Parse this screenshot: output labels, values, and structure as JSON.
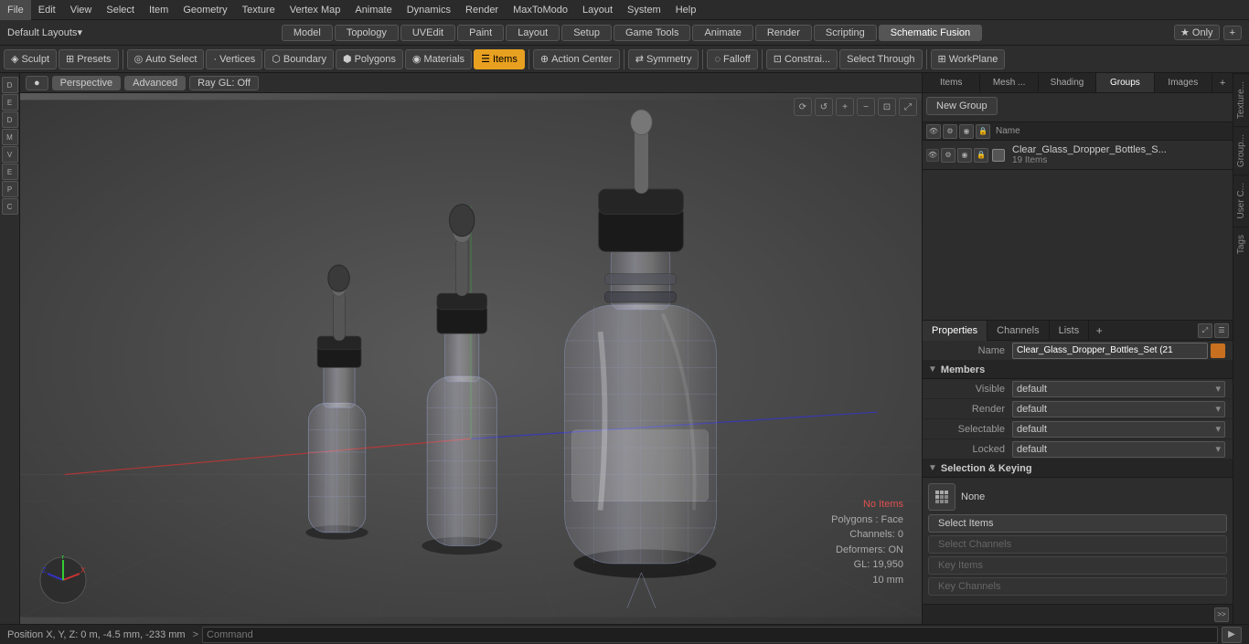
{
  "menubar": {
    "items": [
      "File",
      "Edit",
      "View",
      "Select",
      "Item",
      "Geometry",
      "Texture",
      "Vertex Map",
      "Animate",
      "Dynamics",
      "Render",
      "MaxToModo",
      "Layout",
      "System",
      "Help"
    ]
  },
  "layout_bar": {
    "layout_label": "Default Layouts",
    "tabs": [
      "Model",
      "Topology",
      "UVEdit",
      "Paint",
      "Layout",
      "Setup",
      "Game Tools",
      "Animate",
      "Render",
      "Scripting",
      "Schematic Fusion"
    ],
    "active_tab": "Schematic Fusion",
    "star_label": "★ Only",
    "plus_label": "+"
  },
  "toolbar": {
    "sculpt": "Sculpt",
    "presets": "Presets",
    "auto_select": "Auto Select",
    "vertices": "Vertices",
    "boundary": "Boundary",
    "polygons": "Polygons",
    "materials": "Materials",
    "items": "Items",
    "action_center": "Action Center",
    "symmetry": "Symmetry",
    "falloff": "Falloff",
    "constrain": "Constrai...",
    "select_through": "Select Through",
    "workplane": "WorkPlane"
  },
  "viewport": {
    "mode": "Perspective",
    "render": "Advanced",
    "gl": "Ray GL: Off"
  },
  "right_panel": {
    "tabs": [
      "Items",
      "Mesh ...",
      "Shading",
      "Groups",
      "Images"
    ],
    "active_tab": "Groups",
    "new_group": "New Group",
    "header_name": "Name",
    "group_name": "Clear_Glass_Dropper_Bottles_S...",
    "group_count": "19 Items"
  },
  "properties": {
    "tabs": [
      "Properties",
      "Channels",
      "Lists"
    ],
    "active_tab": "Properties",
    "name_label": "Name",
    "name_value": "Clear_Glass_Dropper_Bottles_Set (21",
    "members_label": "Members",
    "visible_label": "Visible",
    "visible_value": "default",
    "render_label": "Render",
    "render_value": "default",
    "selectable_label": "Selectable",
    "selectable_value": "default",
    "locked_label": "Locked",
    "locked_value": "default",
    "sel_keying_label": "Selection & Keying",
    "none_label": "None",
    "select_items": "Select Items",
    "select_channels": "Select Channels",
    "key_items": "Key Items",
    "key_channels": "Key Channels"
  },
  "info_overlay": {
    "no_items": "No Items",
    "polygons": "Polygons : Face",
    "channels": "Channels: 0",
    "deformers": "Deformers: ON",
    "gl": "GL: 19,950",
    "mm": "10 mm"
  },
  "statusbar": {
    "position": "Position X, Y, Z:  0 m, -4.5 mm, -233 mm",
    "cmd_prompt": ">",
    "cmd_placeholder": "Command"
  },
  "right_side_tabs": [
    "Texture...",
    "Group...",
    "User C...",
    "Tags"
  ]
}
